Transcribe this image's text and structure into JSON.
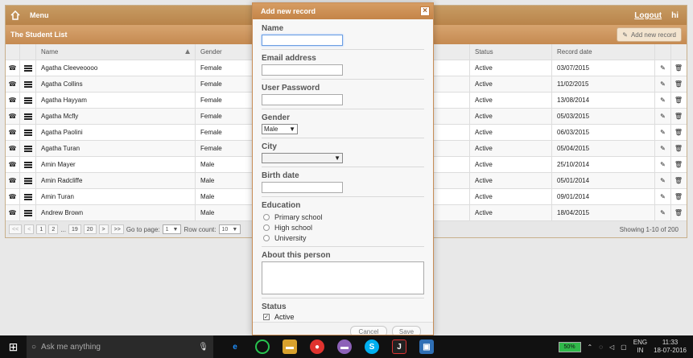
{
  "topbar": {
    "menu": "Menu",
    "logout": "Logout",
    "hi": "hi"
  },
  "list": {
    "title": "The Student List",
    "add_label": "Add new record"
  },
  "columns": [
    "Name",
    "Gender",
    "Status",
    "Record date"
  ],
  "rows": [
    {
      "name": "Agatha Cleeveoooo",
      "gender": "Female",
      "status": "Active",
      "date": "03/07/2015"
    },
    {
      "name": "Agatha Collins",
      "gender": "Female",
      "status": "Active",
      "date": "11/02/2015"
    },
    {
      "name": "Agatha Hayyam",
      "gender": "Female",
      "status": "Active",
      "date": "13/08/2014"
    },
    {
      "name": "Agatha Mcfly",
      "gender": "Female",
      "status": "Active",
      "date": "05/03/2015"
    },
    {
      "name": "Agatha Paolini",
      "gender": "Female",
      "status": "Active",
      "date": "06/03/2015"
    },
    {
      "name": "Agatha Turan",
      "gender": "Female",
      "status": "Active",
      "date": "05/04/2015"
    },
    {
      "name": "Amin Mayer",
      "gender": "Male",
      "status": "Active",
      "date": "25/10/2014"
    },
    {
      "name": "Amin Radcliffe",
      "gender": "Male",
      "status": "Active",
      "date": "05/01/2014"
    },
    {
      "name": "Amin Turan",
      "gender": "Male",
      "status": "Active",
      "date": "09/01/2014"
    },
    {
      "name": "Andrew Brown",
      "gender": "Male",
      "status": "Active",
      "date": "18/04/2015"
    }
  ],
  "pager": {
    "first": "<<",
    "prev": "<",
    "p1": "1",
    "p2": "2",
    "ellipsis": "...",
    "p19": "19",
    "p20": "20",
    "next": ">",
    "last": ">>",
    "goto_label": "Go to page:",
    "goto_value": "1",
    "row_count_label": "Row count:",
    "row_count_value": "10",
    "showing": "Showing 1-10 of 200"
  },
  "modal": {
    "title": "Add new record",
    "name_label": "Name",
    "email_label": "Email address",
    "password_label": "User Password",
    "gender_label": "Gender",
    "gender_value": "Male",
    "city_label": "City",
    "birth_label": "Birth date",
    "education_label": "Education",
    "education_options": [
      "Primary school",
      "High school",
      "University"
    ],
    "about_label": "About this person",
    "status_label": "Status",
    "active_label": "Active",
    "cancel": "Cancel",
    "save": "Save"
  },
  "taskbar": {
    "search_placeholder": "Ask me anything",
    "battery": "50%",
    "lang1": "ENG",
    "lang2": "IN",
    "time": "11:33",
    "date": "18-07-2016"
  },
  "colors": {
    "accent": "#c48448",
    "accent_light": "#d7a46f",
    "taskbar": "#111111",
    "battery": "#30b84a"
  },
  "icons": [
    "home-icon",
    "phone-icon",
    "list-icon",
    "edit-icon",
    "trash-icon",
    "close-icon",
    "windows-icon",
    "search-icon",
    "microphone-icon"
  ]
}
